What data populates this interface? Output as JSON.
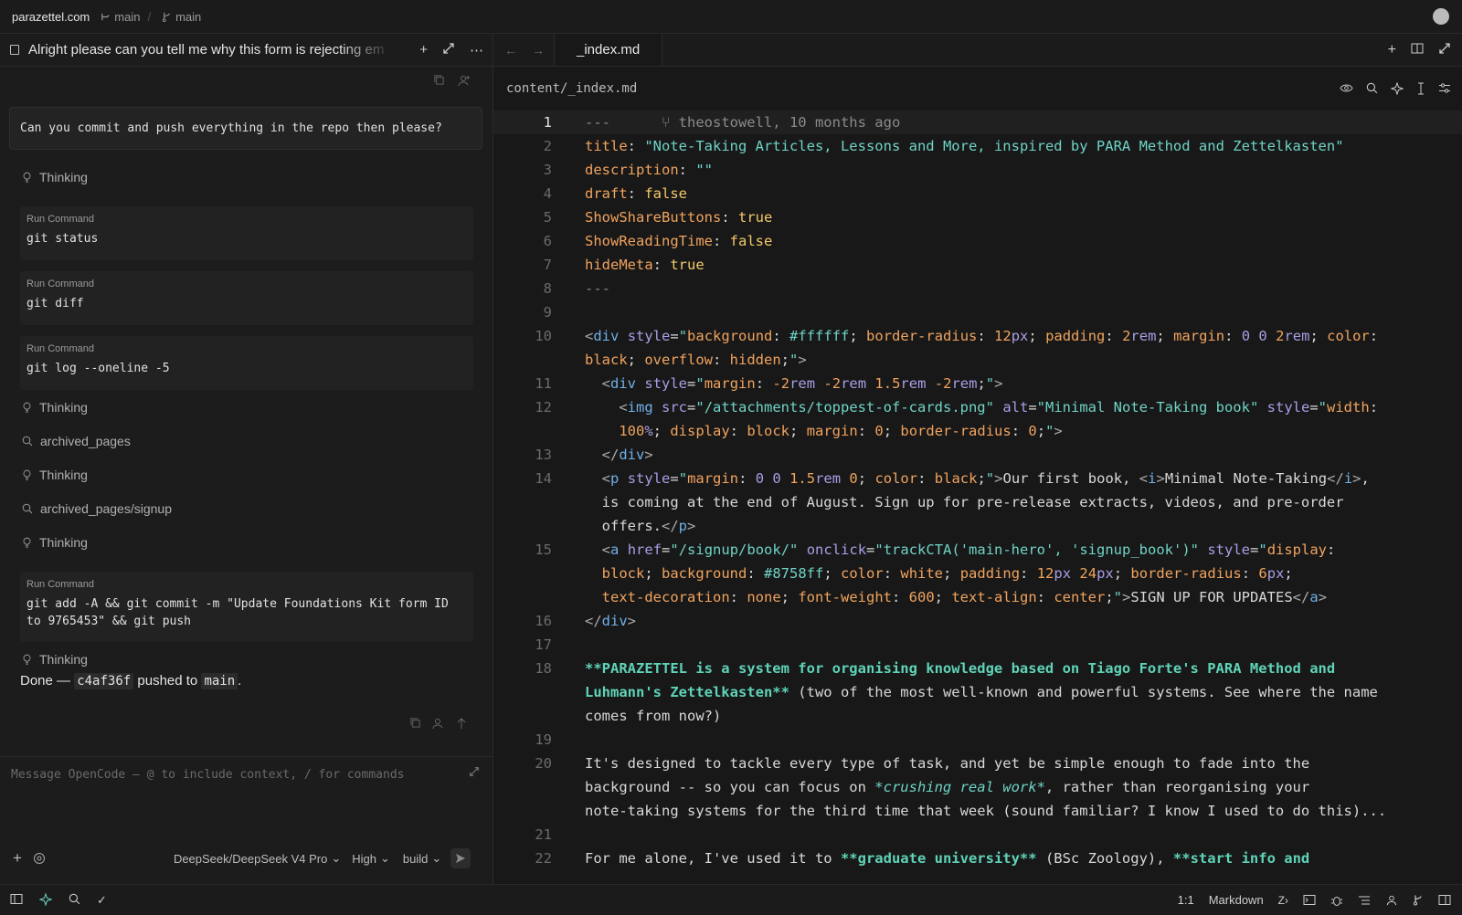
{
  "topbar": {
    "site": "parazettel.com",
    "branch1": "main",
    "branch2": "main"
  },
  "chat": {
    "title": "Alright please can you tell me why this form is rejecting em",
    "user_message": "Can you commit and push everything in the repo then please?",
    "steps": [
      {
        "kind": "thinking",
        "label": "Thinking"
      },
      {
        "kind": "command",
        "label": "Run Command",
        "code": "git status"
      },
      {
        "kind": "command",
        "label": "Run Command",
        "code": "git diff"
      },
      {
        "kind": "command",
        "label": "Run Command",
        "code": "git log --oneline -5"
      },
      {
        "kind": "thinking",
        "label": "Thinking"
      },
      {
        "kind": "search",
        "label": "archived_pages"
      },
      {
        "kind": "thinking",
        "label": "Thinking"
      },
      {
        "kind": "search",
        "label": "archived_pages/signup"
      },
      {
        "kind": "thinking",
        "label": "Thinking"
      },
      {
        "kind": "command",
        "label": "Run Command",
        "code": "git add -A && git commit -m \"Update Foundations Kit form ID to 9765453\" && git push"
      },
      {
        "kind": "thinking",
        "label": "Thinking"
      }
    ],
    "done": {
      "prefix": "Done — ",
      "hash": "c4af36f",
      "mid": " pushed to ",
      "branch": "main",
      "suffix": "."
    },
    "input_placeholder": "Message OpenCode — @ to include context, / for commands",
    "model": "DeepSeek/DeepSeek V4 Pro",
    "effort": "High",
    "mode": "build"
  },
  "editor": {
    "tab": "_index.md",
    "path": "content/_index.md",
    "blame": "theostowell, 10 months ago",
    "lines": [
      {
        "n": "1",
        "y": 0
      },
      {
        "n": "2"
      },
      {
        "n": "3"
      },
      {
        "n": "4"
      },
      {
        "n": "5"
      },
      {
        "n": "6"
      },
      {
        "n": "7"
      },
      {
        "n": "8"
      },
      {
        "n": "9"
      },
      {
        "n": "10"
      },
      {
        "n": "11"
      },
      {
        "n": "12"
      },
      {
        "n": "13"
      },
      {
        "n": "14"
      },
      {
        "n": "15"
      },
      {
        "n": "16"
      },
      {
        "n": "17"
      },
      {
        "n": "18"
      },
      {
        "n": "19"
      },
      {
        "n": "20"
      },
      {
        "n": "21"
      },
      {
        "n": "22"
      }
    ]
  },
  "status": {
    "position": "1:1",
    "language": "Markdown"
  }
}
